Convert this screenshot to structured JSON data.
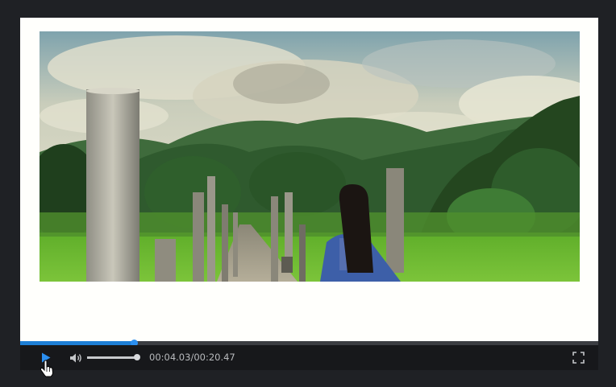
{
  "player": {
    "time": {
      "current": "00:04.03",
      "separator": "/",
      "duration": "00:20.47"
    },
    "progress_fraction": 0.197,
    "volume_fraction": 1.0,
    "state": "paused"
  },
  "colors": {
    "accent": "#1e7fd6",
    "page_background": "#1f2125",
    "control_bar": "#17181b",
    "video_surface": "#fffffc",
    "text": "#b8babd"
  },
  "icons": {
    "play": "play-icon",
    "volume": "volume-icon",
    "fullscreen": "fullscreen-icon",
    "cursor": "hand-pointer-icon"
  }
}
